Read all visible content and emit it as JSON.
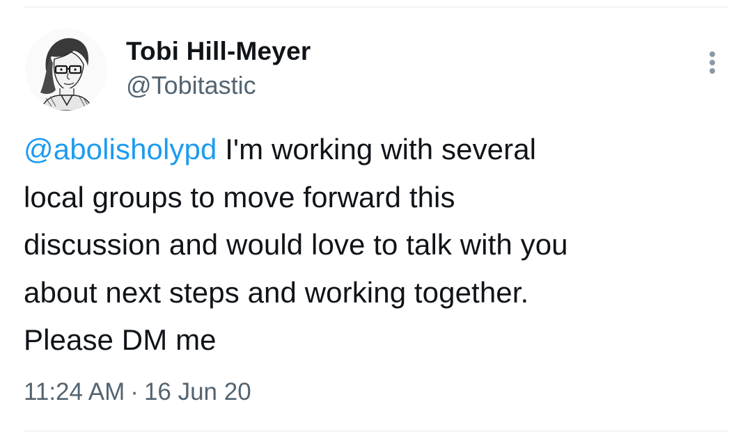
{
  "author": {
    "name": "Tobi Hill-Meyer",
    "handle": "@Tobitastic",
    "avatar_icon": "sketch-portrait-avatar"
  },
  "menu": {
    "icon": "more-vertical-icon"
  },
  "tweet": {
    "mention": "@abolisholypd",
    "lines": [
      " I'm working with several",
      "local groups to move forward this",
      "discussion and would love to talk with you",
      "about next steps and working together.",
      "Please DM me"
    ]
  },
  "meta": {
    "time": "11:24 AM",
    "separator": "·",
    "date": "16 Jun 20"
  },
  "colors": {
    "text": "#0f1419",
    "secondary": "#536471",
    "link": "#1d9bf0",
    "divider": "#eff3f4"
  }
}
